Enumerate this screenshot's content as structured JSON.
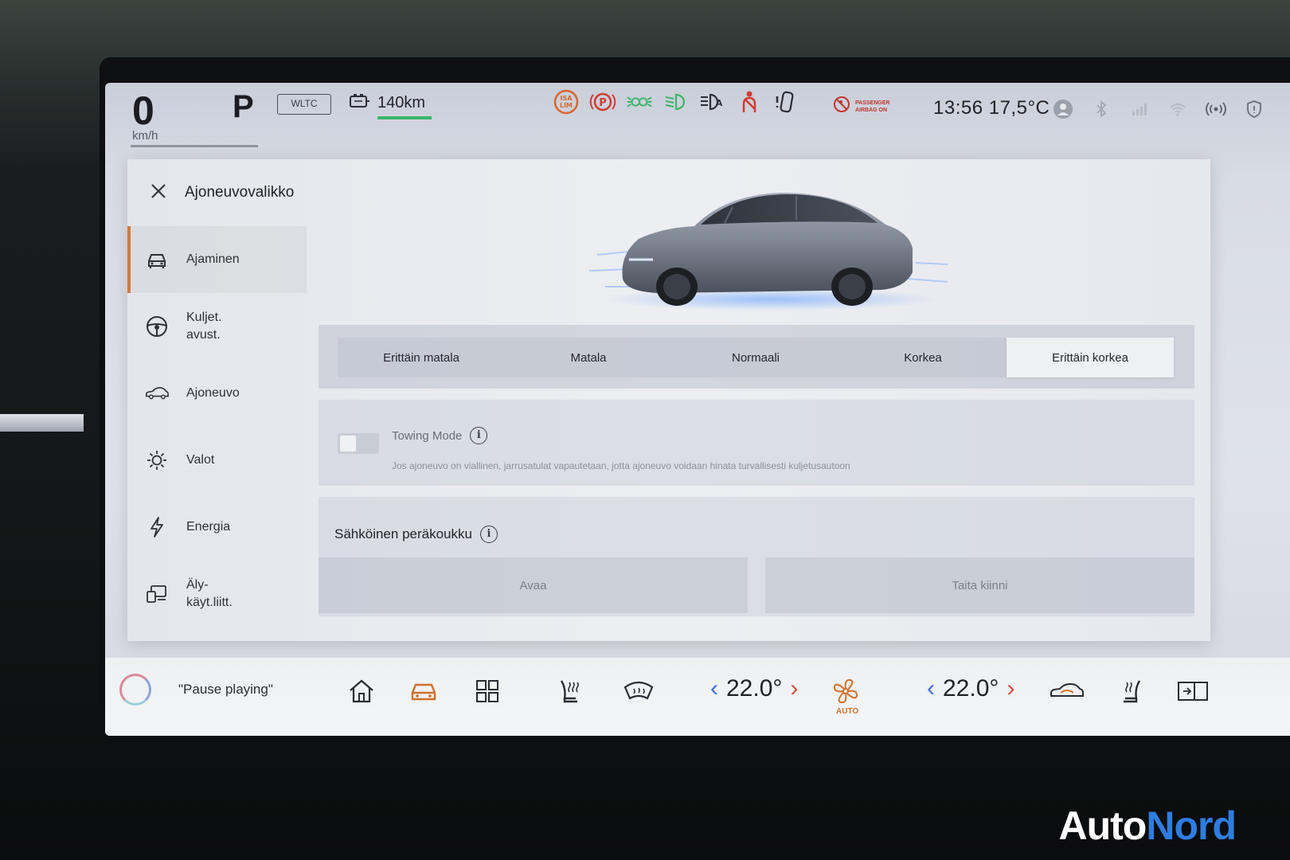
{
  "status": {
    "speed": "0",
    "speed_unit": "km/h",
    "gear": "P",
    "cycle": "WLTC",
    "range": "140km",
    "airbag_line1": "PASSENGER",
    "airbag_line2": "AIRBAG ON",
    "clock": "13:56 17,5°C",
    "warnings": [
      {
        "name": "isa-lim-icon",
        "label": "ISA LIM",
        "color": "#d9652d"
      },
      {
        "name": "parking-brake-icon",
        "label": "(P)",
        "color": "#d13b34"
      },
      {
        "name": "position-lights-icon",
        "label": "",
        "color": "#3bb56a"
      },
      {
        "name": "low-beam-icon",
        "label": "",
        "color": "#3bb56a"
      },
      {
        "name": "auto-headlight-icon",
        "label": "",
        "color": "#2b2e34"
      },
      {
        "name": "seatbelt-icon",
        "label": "",
        "color": "#d13b34"
      },
      {
        "name": "door-open-icon",
        "label": "",
        "color": "#2b2e34"
      }
    ]
  },
  "panel": {
    "title": "Ajoneuvovalikko",
    "sidebar": [
      {
        "name": "sidebar-item-ajaminen",
        "label": "Ajaminen",
        "icon": "car-front-icon",
        "active": true
      },
      {
        "name": "sidebar-item-kuljet-avust",
        "label": "Kuljet.\navust.",
        "icon": "steering-wheel-icon",
        "active": false
      },
      {
        "name": "sidebar-item-ajoneuvo",
        "label": "Ajoneuvo",
        "icon": "car-side-icon",
        "active": false
      },
      {
        "name": "sidebar-item-valot",
        "label": "Valot",
        "icon": "sun-icon",
        "active": false
      },
      {
        "name": "sidebar-item-energia",
        "label": "Energia",
        "icon": "lightning-icon",
        "active": false
      },
      {
        "name": "sidebar-item-aly-kayt",
        "label": "Äly-\nkäyt.liitt.",
        "icon": "device-connect-icon",
        "active": false
      }
    ],
    "height_options": [
      {
        "label": "Erittäin matala",
        "selected": false
      },
      {
        "label": "Matala",
        "selected": false
      },
      {
        "label": "Normaali",
        "selected": false
      },
      {
        "label": "Korkea",
        "selected": false
      },
      {
        "label": "Erittäin korkea",
        "selected": true
      }
    ],
    "towing": {
      "title": "Towing Mode",
      "description": "Jos ajoneuvo on viallinen, jarrusatulat vapautetaan, jotta ajoneuvo voidaan hinata turvallisesti kuljetusautoon",
      "enabled": false
    },
    "hitch": {
      "title": "Sähköinen peräkoukku",
      "open_label": "Avaa",
      "fold_label": "Taita kiinni"
    }
  },
  "dock": {
    "voice_text": "\"Pause playing\"",
    "temp_left": "22.0°",
    "temp_right": "22.0°",
    "fan_label": "AUTO",
    "accent": "#d0702e"
  },
  "brand": {
    "part1": "Auto",
    "part2": "Nord"
  }
}
